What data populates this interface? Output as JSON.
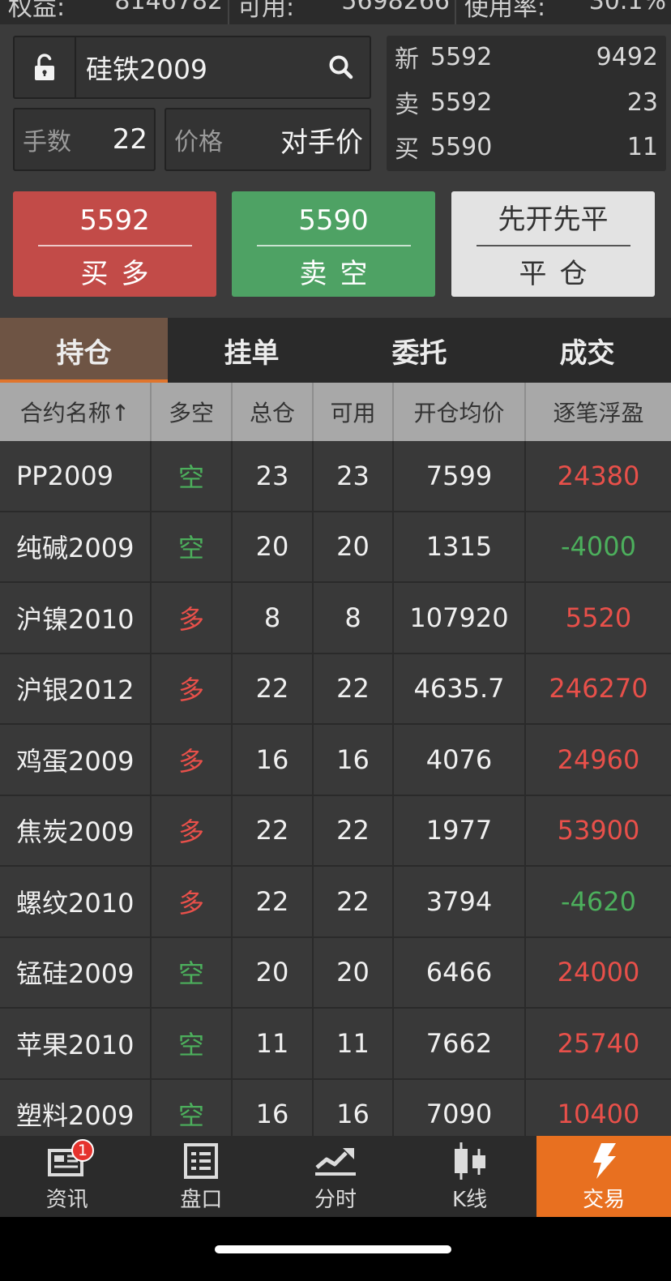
{
  "account_bar": [
    {
      "label": "权益:",
      "value": "8146782"
    },
    {
      "label": "可用:",
      "value": "5698266"
    },
    {
      "label": "使用率:",
      "value": "30.1%"
    }
  ],
  "order": {
    "symbol": "硅铁2009",
    "qty_label": "手数",
    "qty_value": "22",
    "price_label": "价格",
    "price_value": "对手价"
  },
  "quote": [
    {
      "label": "新",
      "price": "5592",
      "volume": "9492"
    },
    {
      "label": "卖",
      "price": "5592",
      "volume": "23"
    },
    {
      "label": "买",
      "price": "5590",
      "volume": "11"
    }
  ],
  "buttons": {
    "buy": {
      "price": "5592",
      "label": "买多"
    },
    "sell": {
      "price": "5590",
      "label": "卖空"
    },
    "close": {
      "mode": "先开先平",
      "label": "平仓"
    }
  },
  "tabs": [
    "持仓",
    "挂单",
    "委托",
    "成交"
  ],
  "active_tab": "持仓",
  "table": {
    "headers": [
      "合约名称↑",
      "多空",
      "总仓",
      "可用",
      "开仓均价",
      "逐笔浮盈"
    ],
    "rows": [
      {
        "name": "PP2009",
        "dir": "空",
        "total": "23",
        "avail": "23",
        "avg": "7599",
        "pnl": "24380"
      },
      {
        "name": "纯碱2009",
        "dir": "空",
        "total": "20",
        "avail": "20",
        "avg": "1315",
        "pnl": "-4000"
      },
      {
        "name": "沪镍2010",
        "dir": "多",
        "total": "8",
        "avail": "8",
        "avg": "107920",
        "pnl": "5520"
      },
      {
        "name": "沪银2012",
        "dir": "多",
        "total": "22",
        "avail": "22",
        "avg": "4635.7",
        "pnl": "246270"
      },
      {
        "name": "鸡蛋2009",
        "dir": "多",
        "total": "16",
        "avail": "16",
        "avg": "4076",
        "pnl": "24960"
      },
      {
        "name": "焦炭2009",
        "dir": "多",
        "total": "22",
        "avail": "22",
        "avg": "1977",
        "pnl": "53900"
      },
      {
        "name": "螺纹2010",
        "dir": "多",
        "total": "22",
        "avail": "22",
        "avg": "3794",
        "pnl": "-4620"
      },
      {
        "name": "锰硅2009",
        "dir": "空",
        "total": "20",
        "avail": "20",
        "avg": "6466",
        "pnl": "24000"
      },
      {
        "name": "苹果2010",
        "dir": "空",
        "total": "11",
        "avail": "11",
        "avg": "7662",
        "pnl": "25740"
      },
      {
        "name": "塑料2009",
        "dir": "空",
        "total": "16",
        "avail": "16",
        "avg": "7090",
        "pnl": "10400"
      }
    ]
  },
  "nav": [
    {
      "label": "资讯",
      "icon": "news-icon",
      "badge": "1"
    },
    {
      "label": "盘口",
      "icon": "orderbook-icon"
    },
    {
      "label": "分时",
      "icon": "intraday-chart-icon"
    },
    {
      "label": "K线",
      "icon": "candlestick-icon"
    },
    {
      "label": "交易",
      "icon": "lightning-icon",
      "active": true
    }
  ],
  "colors": {
    "up": "#e8504a",
    "down": "#4caf5c",
    "accent": "#e87020",
    "buy_button": "#c24b48",
    "sell_button": "#4ea264"
  }
}
